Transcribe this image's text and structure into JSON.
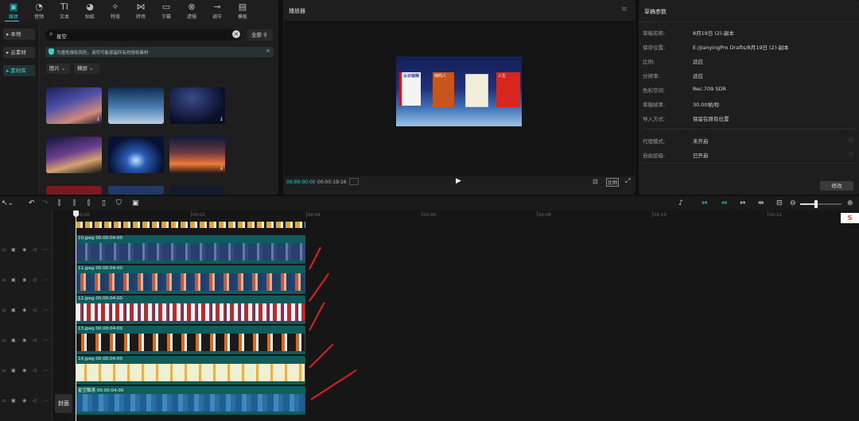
{
  "toolbar": {
    "tabs": [
      {
        "label": "媒体",
        "icon": "media-icon",
        "active": true
      },
      {
        "label": "音频",
        "icon": "audio-icon"
      },
      {
        "label": "文本",
        "icon": "text-icon"
      },
      {
        "label": "贴纸",
        "icon": "sticker-icon"
      },
      {
        "label": "特效",
        "icon": "effects-icon"
      },
      {
        "label": "转场",
        "icon": "transition-icon"
      },
      {
        "label": "字幕",
        "icon": "subtitle-icon"
      },
      {
        "label": "滤镜",
        "icon": "filter-icon"
      },
      {
        "label": "调节",
        "icon": "adjust-icon"
      },
      {
        "label": "模板",
        "icon": "template-icon"
      }
    ]
  },
  "sidebar": {
    "items": [
      {
        "label": "▸ 本地"
      },
      {
        "label": "▸ 云素材"
      },
      {
        "label": "▸ 素材库",
        "active": true
      }
    ]
  },
  "search": {
    "value": "星空",
    "filter_label": "全部"
  },
  "notice": {
    "text": "为避免侵权风险，请尽可能保留所有的授权素材"
  },
  "filters": {
    "type": "图片",
    "orientation": "横屏"
  },
  "player": {
    "title": "播放器",
    "current_time": "00:00:00:00",
    "total_time": "00:00:19:16",
    "ratio_label": "比例",
    "book_labels": [
      "认识视频",
      "她的人",
      "",
      "人生"
    ]
  },
  "draft": {
    "title": "草稿参数",
    "fields": [
      {
        "label": "草稿名称:",
        "value": "8月19日 (2)-副本"
      },
      {
        "label": "保存位置:",
        "value": "E:/JianyingPro Drafts/8月19日 (2)-副本"
      },
      {
        "label": "比例:",
        "value": "适应"
      },
      {
        "label": "分辨率:",
        "value": "适应"
      },
      {
        "label": "色彩空间:",
        "value": "Rec.709 SDR"
      },
      {
        "label": "草稿帧率:",
        "value": "30.00帧/秒"
      },
      {
        "label": "导入方式:",
        "value": "保留在原有位置"
      }
    ],
    "fields2": [
      {
        "label": "代理模式:",
        "value": "未开启"
      },
      {
        "label": "自由层级:",
        "value": "已开启"
      }
    ],
    "edit_button": "修改"
  },
  "timeline": {
    "ruler": [
      "00:00",
      "00:02",
      "00:04",
      "00:06",
      "00:08",
      "00:10",
      "00:12"
    ],
    "clips": [
      {
        "name": "10.jpeg",
        "duration": "00:00:04:00"
      },
      {
        "name": "11.jpeg",
        "duration": "00:00:04:00"
      },
      {
        "name": "12.jpeg",
        "duration": "00:00:04:00"
      },
      {
        "name": "13.jpeg",
        "duration": "00:00:04:00"
      },
      {
        "name": "14.jpeg",
        "duration": "00:00:04:00"
      },
      {
        "name": "星空飘落",
        "duration": "00:00:04:00"
      }
    ],
    "cover_label": "封面"
  },
  "colors": {
    "accent": "#33d1d1",
    "clip": "#0e5d5c",
    "marker": "#e02020"
  }
}
